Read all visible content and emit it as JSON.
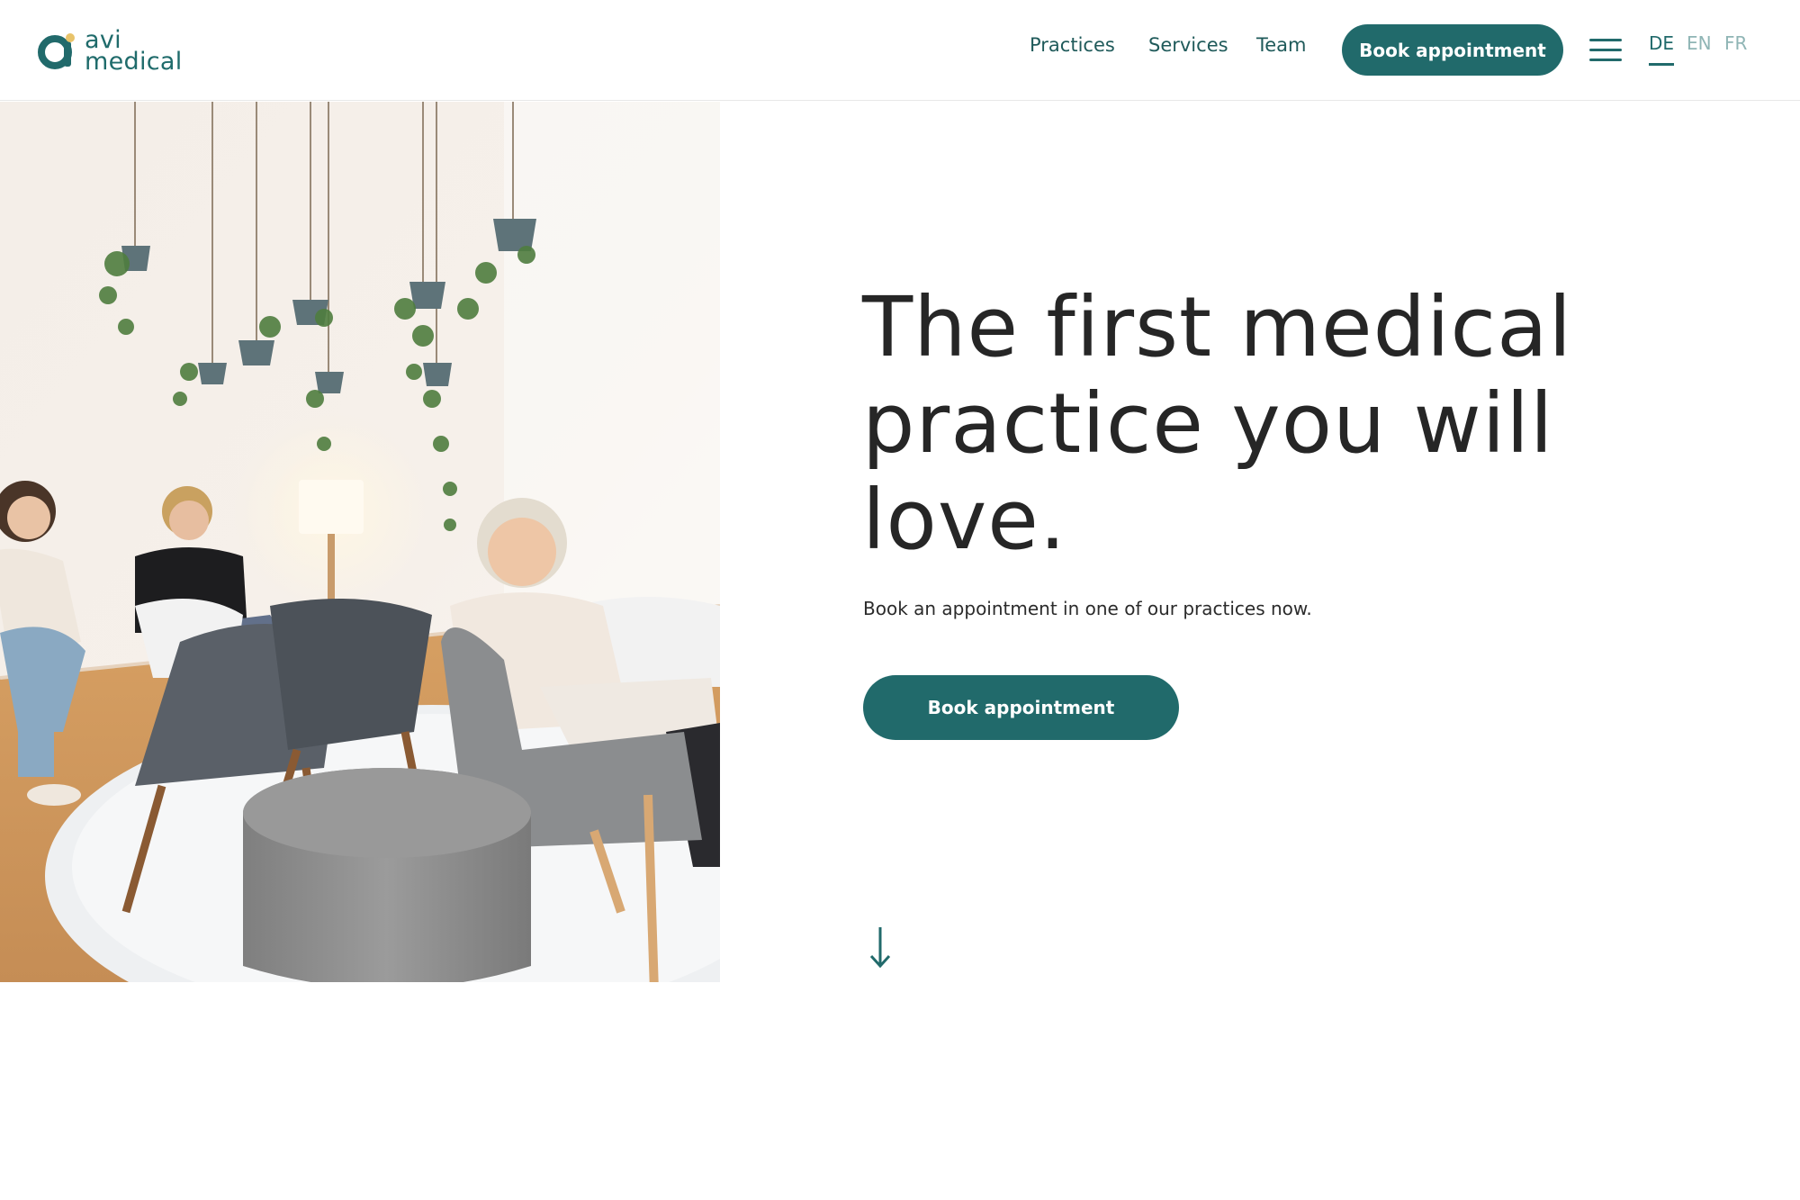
{
  "brand": {
    "line1": "avi",
    "line2": "medical",
    "color": "#216a6b"
  },
  "nav": {
    "items": [
      "Practices",
      "Services",
      "Team"
    ],
    "book_label": "Book appointment",
    "menu_icon": "hamburger-icon"
  },
  "languages": {
    "items": [
      "DE",
      "EN",
      "FR"
    ],
    "active": "DE"
  },
  "hero": {
    "headline": "The first medical practice you will love.",
    "subtitle": "Book an appointment in one of our practices now.",
    "cta_label": "Book appointment",
    "image_alt": "waiting-room-photo",
    "scroll_icon": "arrow-down-icon"
  },
  "colors": {
    "accent": "#216a6b",
    "accent_light": "#8fb5b5",
    "text": "#262626",
    "background": "#ffffff"
  }
}
